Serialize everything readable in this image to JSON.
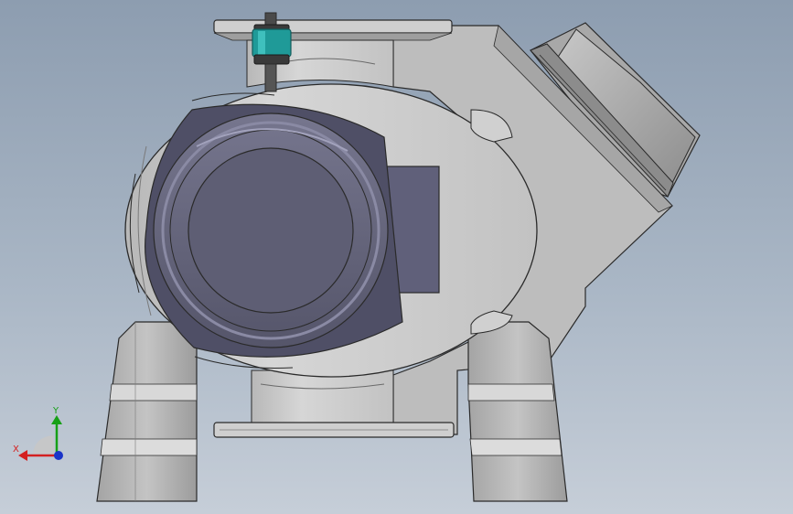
{
  "viewport": {
    "background_top": "#8d9db0",
    "background_bottom": "#c6ced8"
  },
  "triad": {
    "x_label": "X",
    "y_label": "Y",
    "x_color": "#d42020",
    "y_color": "#16a016",
    "z_color": "#1a34c8"
  },
  "colors": {
    "body": "#c9c9c9",
    "body_dark": "#9a9a9a",
    "outline": "#2a2a2a",
    "flange_face": "#5e5e74",
    "flange_ring": "#6c6c86",
    "actuator": "#1f9a98"
  }
}
